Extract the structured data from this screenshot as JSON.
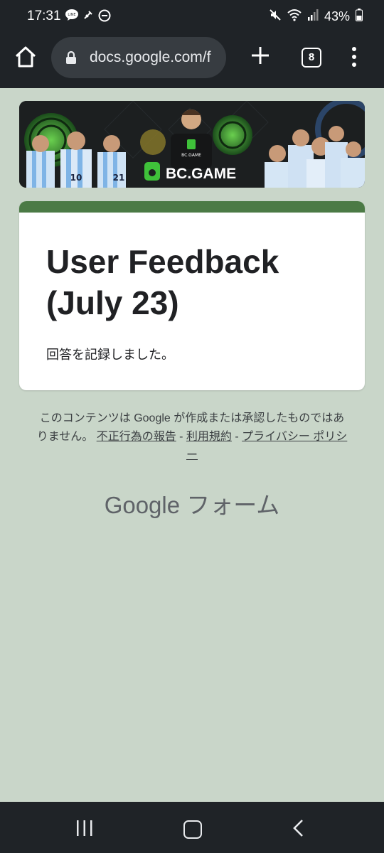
{
  "status_bar": {
    "time": "17:31",
    "battery": "43%"
  },
  "browser": {
    "url": "docs.google.com/f",
    "tab_count": "8"
  },
  "banner": {
    "brand": "BC.GAME",
    "jersey_numbers": [
      "10",
      "21"
    ],
    "mini_brand": "BC.GAME"
  },
  "form": {
    "title": "User Feedback (July 23)",
    "confirmation": "回答を記録しました。",
    "accent_color": "#4b7a45"
  },
  "footer": {
    "disclaimer": "このコンテンツは Google が作成または承認したものではありません。",
    "report_link": "不正行為の報告",
    "sep1": " - ",
    "terms_link": "利用規約",
    "sep2": " - ",
    "privacy_link": "プライバシー ポリシー",
    "brand_google": "Google",
    "brand_forms": "フォーム"
  }
}
